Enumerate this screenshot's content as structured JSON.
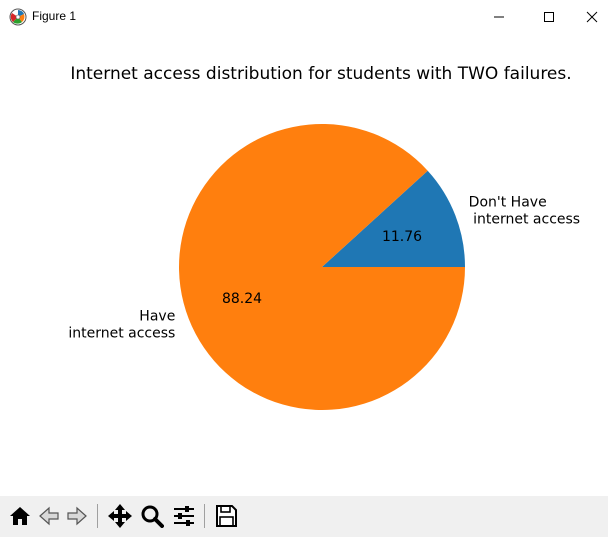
{
  "window": {
    "title": "Figure 1",
    "icon": "matplotlib-logo-icon",
    "controls": [
      "minimize-icon",
      "maximize-icon",
      "close-icon"
    ]
  },
  "chart_data": {
    "type": "pie",
    "title": "Internet access distribution for students with TWO failures.",
    "categories": [
      "Don't Have\n internet access",
      "Have\ninternet access"
    ],
    "values": [
      11.76,
      88.24
    ],
    "value_labels": [
      "11.76",
      "88.24"
    ],
    "colors": [
      "#1f77b4",
      "#ff7f0e"
    ],
    "start_angle_deg": 0,
    "legend": "none"
  },
  "toolbar": {
    "buttons": [
      "home-icon",
      "back-arrow-icon",
      "forward-arrow-icon",
      "pan-icon",
      "zoom-icon",
      "configure-subplots-icon",
      "save-icon"
    ]
  }
}
